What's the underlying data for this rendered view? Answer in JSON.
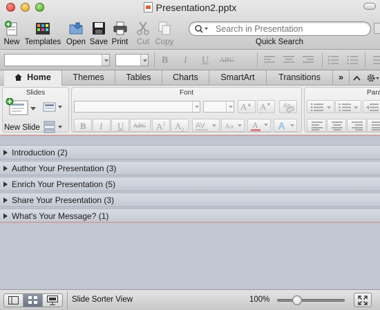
{
  "window": {
    "title": "Presentation2.pptx"
  },
  "toolbar": {
    "items": [
      {
        "label": "New",
        "icon": "new-presentation-icon"
      },
      {
        "label": "Templates",
        "icon": "templates-icon"
      },
      {
        "label": "Open",
        "icon": "open-folder-icon"
      },
      {
        "label": "Save",
        "icon": "save-disk-icon"
      },
      {
        "label": "Print",
        "icon": "printer-icon"
      },
      {
        "label": "Cut",
        "icon": "scissors-icon",
        "enabled": false
      },
      {
        "label": "Copy",
        "icon": "copy-icon",
        "enabled": false
      }
    ],
    "search_placeholder": "Search in Presentation",
    "quick_search_label": "Quick Search"
  },
  "format_bar": {
    "glyphs": [
      "B",
      "I",
      "U",
      "ABC"
    ]
  },
  "ribbon": {
    "tabs": [
      {
        "label": "Home",
        "active": true
      },
      {
        "label": "Themes"
      },
      {
        "label": "Tables"
      },
      {
        "label": "Charts"
      },
      {
        "label": "SmartArt"
      },
      {
        "label": "Transitions"
      }
    ],
    "overflow_label": "»",
    "groups": {
      "slides": {
        "title": "Slides",
        "new_slide_label": "New Slide"
      },
      "font": {
        "title": "Font"
      },
      "paragraph": {
        "title": "Para"
      }
    }
  },
  "sections": [
    {
      "label": "Introduction (2)"
    },
    {
      "label": "Author Your Presentation (3)"
    },
    {
      "label": "Enrich Your Presentation (5)"
    },
    {
      "label": "Share Your Presentation (3)"
    },
    {
      "label": "What's Your Message? (1)"
    }
  ],
  "status": {
    "view_name": "Slide Sorter View",
    "zoom": "100%",
    "zoom_level_fraction": 0.25,
    "active_view": "slide-sorter"
  },
  "colors": {
    "accent_line": "#c9a6a6",
    "content_bg": "#c1c7d1"
  }
}
